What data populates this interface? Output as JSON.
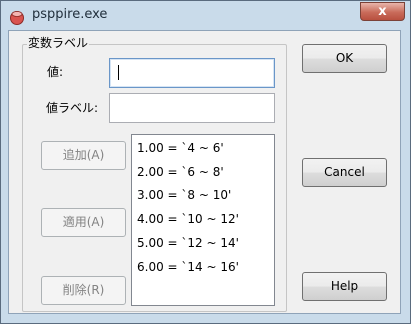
{
  "window": {
    "title": "psppire.exe",
    "close_label": "x"
  },
  "group": {
    "label": "変数ラベル"
  },
  "fields": {
    "value_label": "値:",
    "value_input": "",
    "value_label_label": "値ラベル:",
    "value_label_input": ""
  },
  "buttons": {
    "add": "追加(A)",
    "change": "適用(A)",
    "remove": "削除(R)",
    "ok": "OK",
    "cancel": "Cancel",
    "help": "Help"
  },
  "labels_list": [
    "1.00 = `4 ~ 6'",
    "2.00 = `6 ~ 8'",
    "3.00 = `8 ~ 10'",
    "4.00 = `10 ~ 12'",
    "5.00 = `12 ~ 14'",
    "6.00 = `14 ~ 16'"
  ],
  "colors": {
    "frame": "#c9dbea",
    "client": "#f0f0f0",
    "close": "#c96b5a"
  }
}
